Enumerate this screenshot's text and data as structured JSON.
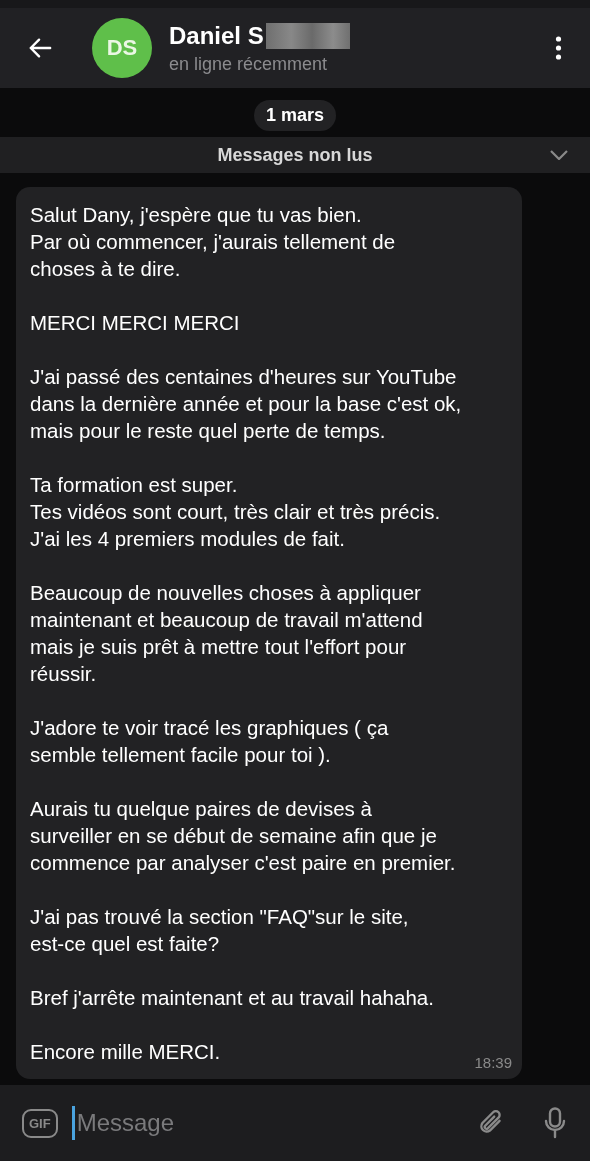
{
  "header": {
    "avatar_initials": "DS",
    "name": "Daniel S",
    "status": "en ligne récemment"
  },
  "date_chip": "1 mars",
  "unread_bar": {
    "label": "Messages non lus"
  },
  "message": {
    "paragraphs": [
      "Salut Dany,  j'espère que tu vas bien.\nPar où commencer, j'aurais tellement de\nchoses à te dire.",
      "MERCI MERCI MERCI",
      "J'ai passé des centaines d'heures sur YouTube\ndans la dernière année et pour la base c'est ok,\nmais pour le reste quel perte de temps.",
      "Ta formation est super.\nTes vidéos sont court, très clair et très précis.\nJ'ai les 4 premiers modules de fait.",
      "Beaucoup de nouvelles choses à appliquer\nmaintenant et beaucoup de travail m'attend\nmais je suis prêt à mettre tout l'effort pour\nréussir.",
      "J'adore te voir tracé les graphiques ( ça\nsemble tellement facile pour toi ).",
      "Aurais tu quelque paires de devises à\nsurveiller en se début de semaine afin que je\ncommence par analyser c'est paire en premier.",
      "J'ai pas trouvé la section \"FAQ\"sur le site,\nest-ce quel est faite?",
      "Bref j'arrête maintenant et au travail hahaha.",
      "Encore mille MERCI."
    ],
    "time": "18:39"
  },
  "composer": {
    "gif_label": "GIF",
    "placeholder": "Message"
  }
}
